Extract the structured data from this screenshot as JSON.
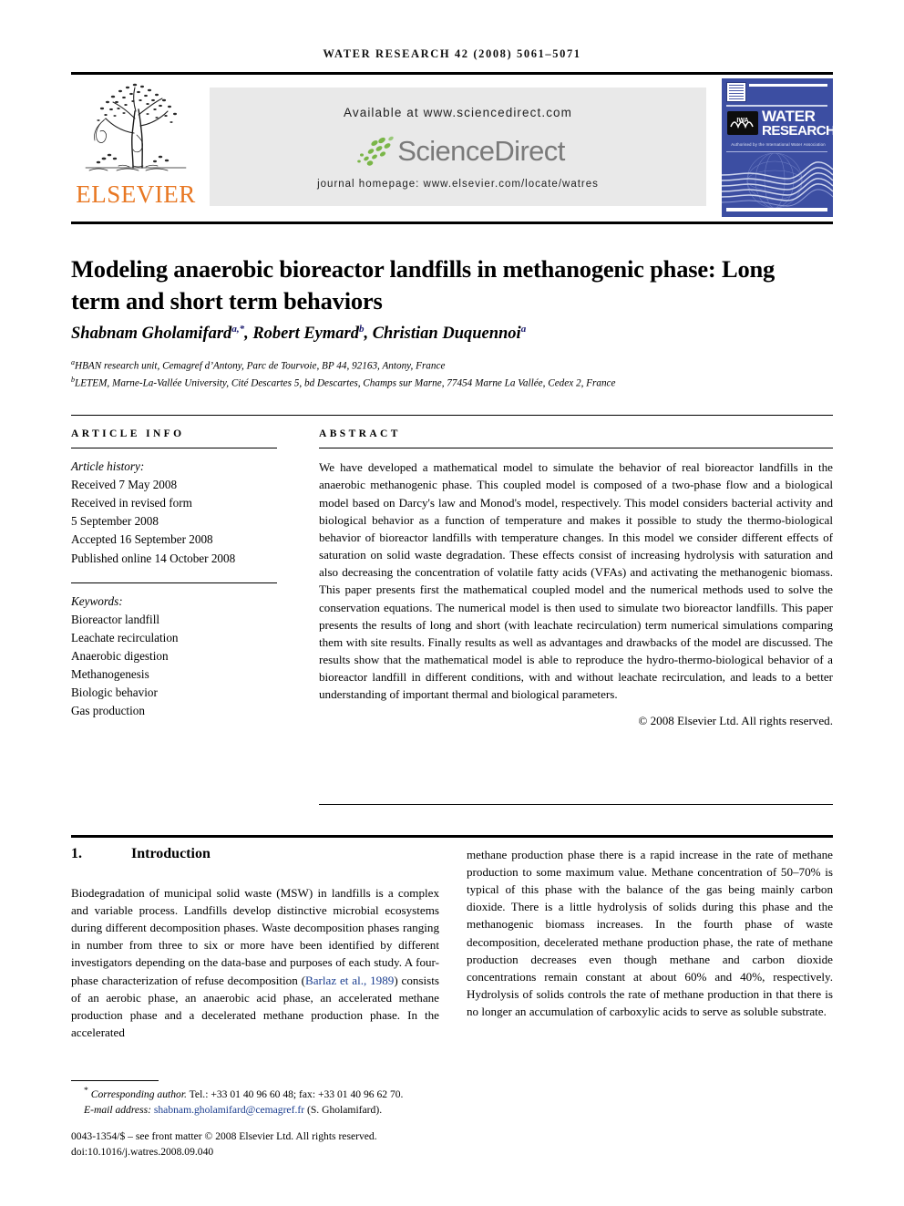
{
  "running_head": "WATER RESEARCH 42 (2008) 5061–5071",
  "masthead": {
    "publisher_name": "ELSEVIER",
    "publisher_logo_alt": "elsevier-tree-logo",
    "available_at": "Available at www.sciencedirect.com",
    "sciencedirect_wordmark": "ScienceDirect",
    "journal_homepage": "journal homepage: www.elsevier.com/locate/watres",
    "cover": {
      "line1": "WATER",
      "line2": "RESEARCH",
      "tagline": "Authorised by the International Water Association",
      "iwa_label": "IWA"
    }
  },
  "article": {
    "title": "Modeling anaerobic bioreactor landfills in methanogenic phase: Long term and short term behaviors",
    "authors": "Shabnam Gholamifard, Robert Eymard, Christian Duquennoi",
    "author_list": [
      {
        "name": "Shabnam Gholamifard",
        "sup": "a,*"
      },
      {
        "name": "Robert Eymard",
        "sup": "b"
      },
      {
        "name": "Christian Duquennoi",
        "sup": "a"
      }
    ],
    "affiliations": [
      {
        "mark": "a",
        "text": "HBAN research unit, Cemagref d’Antony, Parc de Tourvoie, BP 44, 92163, Antony, France"
      },
      {
        "mark": "b",
        "text": "LETEM, Marne-La-Vallée University, Cité Descartes 5, bd Descartes, Champs sur Marne, 77454 Marne La Vallée, Cedex 2, France"
      }
    ]
  },
  "article_info": {
    "heading": "ARTICLE INFO",
    "history_label": "Article history:",
    "history": [
      "Received 7 May 2008",
      "Received in revised form",
      "5 September 2008",
      "Accepted 16 September 2008",
      "Published online 14 October 2008"
    ],
    "keywords_label": "Keywords:",
    "keywords": [
      "Bioreactor landfill",
      "Leachate recirculation",
      "Anaerobic digestion",
      "Methanogenesis",
      "Biologic behavior",
      "Gas production"
    ]
  },
  "abstract": {
    "heading": "ABSTRACT",
    "text": "We have developed a mathematical model to simulate the behavior of real bioreactor landfills in the anaerobic methanogenic phase. This coupled model is composed of a two-phase flow and a biological model based on Darcy's law and Monod's model, respectively. This model considers bacterial activity and biological behavior as a function of temperature and makes it possible to study the thermo-biological behavior of bioreactor landfills with temperature changes. In this model we consider different effects of saturation on solid waste degradation. These effects consist of increasing hydrolysis with saturation and also decreasing the concentration of volatile fatty acids (VFAs) and activating the methanogenic biomass. This paper presents first the mathematical coupled model and the numerical methods used to solve the conservation equations. The numerical model is then used to simulate two bioreactor landfills. This paper presents the results of long and short (with leachate recirculation) term numerical simulations comparing them with site results. Finally results as well as advantages and drawbacks of the model are discussed. The results show that the mathematical model is able to reproduce the hydro-thermo-biological behavior of a bioreactor landfill in different conditions, with and without leachate recirculation, and leads to a better understanding of important thermal and biological parameters.",
    "copyright": "© 2008 Elsevier Ltd. All rights reserved."
  },
  "body": {
    "section_number": "1.",
    "section_title": "Introduction",
    "left_paragraph_pre": "Biodegradation of municipal solid waste (MSW) in landfills is a complex and variable process. Landfills develop distinctive microbial ecosystems during different decomposition phases. Waste decomposition phases ranging in number from three to six or more have been identified by different investigators depending on the data-base and purposes of each study. A four-phase characterization of refuse decomposition (",
    "left_citation": "Barlaz et al., 1989",
    "left_paragraph_post": ") consists of an aerobic phase, an anaerobic acid phase, an accelerated methane production phase and a decelerated methane production phase. In the accelerated",
    "right_paragraph": "methane production phase there is a rapid increase in the rate of methane production to some maximum value. Methane concentration of 50–70% is typical of this phase with the balance of the gas being mainly carbon dioxide. There is a little hydrolysis of solids during this phase and the methanogenic biomass increases. In the fourth phase of waste decomposition, decelerated methane production phase, the rate of methane production decreases even though methane and carbon dioxide concentrations remain constant at about 60% and 40%, respectively. Hydrolysis of solids controls the rate of methane production in that there is no longer an accumulation of carboxylic acids to serve as soluble substrate."
  },
  "footer": {
    "corresponding_marker": "*",
    "corresponding_text": "Corresponding author.",
    "corresponding_tel": "Tel.: +33 01 40 96 60 48; fax: +33 01 40 96 62 70.",
    "email_label": "E-mail address:",
    "email": "shabnam.gholamifard@cemagref.fr",
    "email_owner": "(S. Gholamifard).",
    "issn_line": "0043-1354/$ – see front matter © 2008 Elsevier Ltd. All rights reserved.",
    "doi_line": "doi:10.1016/j.watres.2008.09.040"
  },
  "colors": {
    "elsevier_orange": "#E87722",
    "cover_blue": "#3c4ea2",
    "link_blue": "#1a3d8f",
    "sciencedirect_gray": "#7a7a7a",
    "band_gray": "#e9e9e9"
  }
}
